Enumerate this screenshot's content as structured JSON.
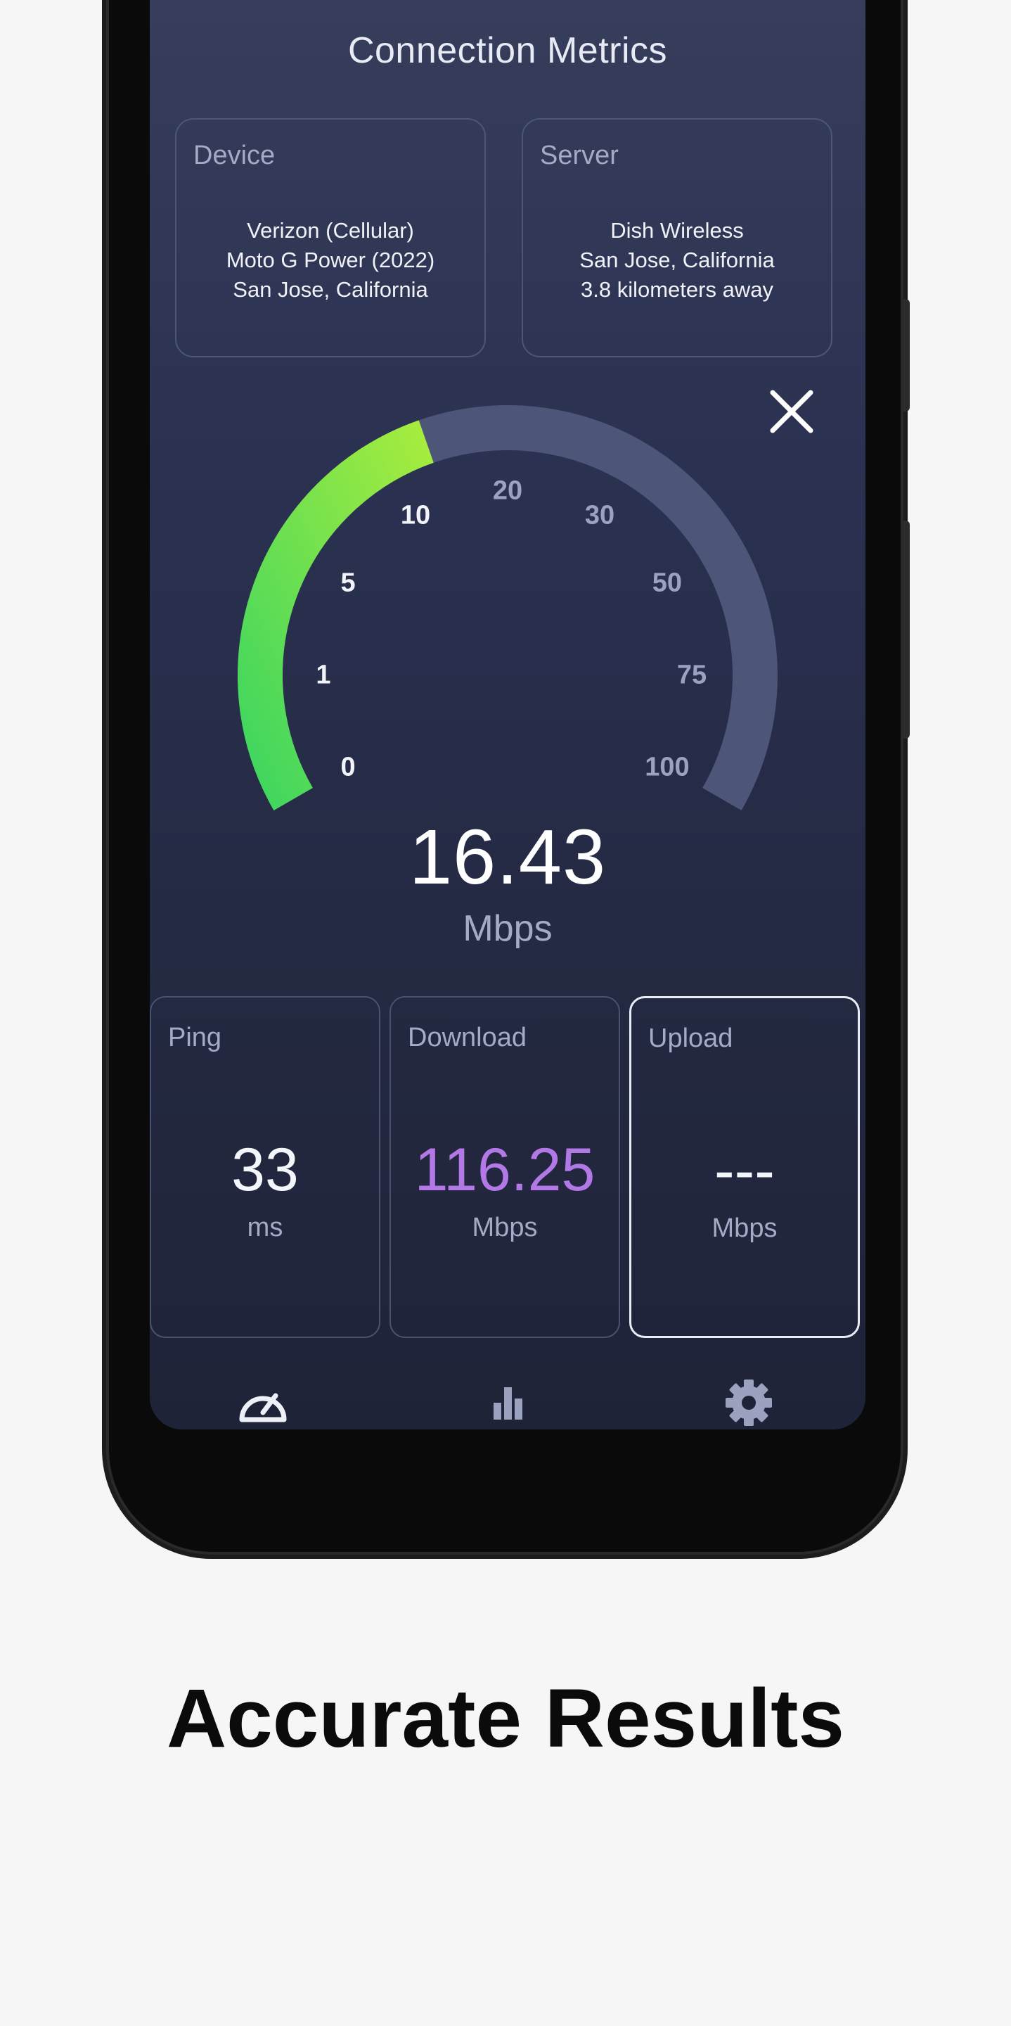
{
  "screen": {
    "title": "Connection Metrics",
    "device": {
      "label": "Device",
      "carrier": "Verizon (Cellular)",
      "model": "Moto G Power (2022)",
      "location": "San Jose, California"
    },
    "server": {
      "label": "Server",
      "provider": "Dish Wireless",
      "location": "San Jose, California",
      "distance": "3.8 kilometers away"
    },
    "gauge": {
      "ticks": [
        "0",
        "1",
        "5",
        "10",
        "20",
        "30",
        "50",
        "75",
        "100"
      ],
      "fill_fraction": 0.42,
      "gradient_colors": [
        "#3fd65f",
        "#a6ec3e"
      ],
      "track_color": "#4d5579"
    },
    "speed": {
      "value": "16.43",
      "unit": "Mbps"
    },
    "metrics": {
      "ping": {
        "label": "Ping",
        "value": "33",
        "unit": "ms"
      },
      "download": {
        "label": "Download",
        "value": "116.25",
        "unit": "Mbps",
        "color": "#b279e6"
      },
      "upload": {
        "label": "Upload",
        "value": "---",
        "unit": "Mbps"
      }
    },
    "nav": [
      "speedometer-icon",
      "bar-chart-icon",
      "gear-icon"
    ]
  },
  "caption": "Accurate Results"
}
